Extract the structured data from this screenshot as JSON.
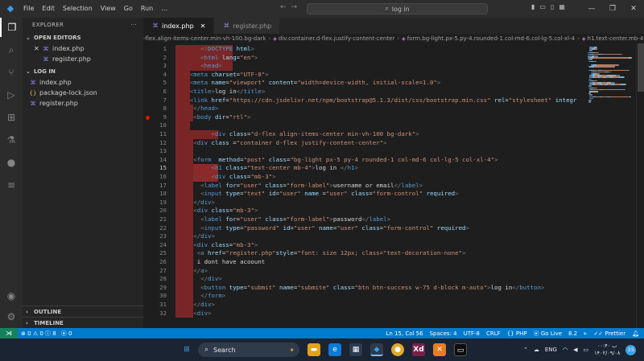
{
  "window": {
    "menu": [
      "File",
      "Edit",
      "Selection",
      "View",
      "Go",
      "Run",
      "…"
    ],
    "search_text": "log in"
  },
  "sidebar": {
    "title": "EXPLORER",
    "open_editors_title": "OPEN EDITORS",
    "open_editors": [
      "index.php",
      "register.php"
    ],
    "folder_title": "LOG IN",
    "files": [
      {
        "name": "index.php",
        "type": "php"
      },
      {
        "name": "package-lock.json",
        "type": "json"
      },
      {
        "name": "register.php",
        "type": "php"
      }
    ],
    "outline_title": "OUTLINE",
    "timeline_title": "TIMELINE"
  },
  "tabs": [
    {
      "label": "index.php",
      "active": true
    },
    {
      "label": "register.php",
      "active": false
    }
  ],
  "breadcrumb": [
    "-flex.align-items-center.min-vh-100.bg-dark",
    "div.container.d-flex.justify-content-center",
    "form.bg-light.px-5.py-4.rounded-1.col-md-6.col-lg-5.col-xl-4",
    "h1.text-center.mb-4"
  ],
  "editor": {
    "current_line": 15,
    "breakpoint_line": 9,
    "lines": [
      {
        "n": 1,
        "indent": 7,
        "hl": [
          8,
          24
        ],
        "seg": [
          [
            "p",
            "<!"
          ],
          [
            "t",
            "DOCTYPE"
          ],
          [
            "a",
            " html"
          ],
          [
            "p",
            ">"
          ]
        ]
      },
      {
        "n": 2,
        "indent": 7,
        "hl": [
          8,
          24
        ],
        "seg": [
          [
            "p",
            "<"
          ],
          [
            "t",
            "html"
          ],
          [
            "a",
            " lang"
          ],
          [
            "x2",
            "="
          ],
          [
            "s",
            "\"en\""
          ],
          [
            "p",
            ">"
          ]
        ]
      },
      {
        "n": 3,
        "indent": 7,
        "hl": [
          8,
          24
        ],
        "seg": [
          [
            "p",
            "<"
          ],
          [
            "t",
            "head"
          ],
          [
            "p",
            ">"
          ]
        ]
      },
      {
        "n": 4,
        "indent": 4,
        "hl": [
          8,
          12
        ],
        "seg": [
          [
            "p",
            "<"
          ],
          [
            "t",
            "meta"
          ],
          [
            "a",
            " charset"
          ],
          [
            "x2",
            "="
          ],
          [
            "s",
            "\"UTF-8\""
          ],
          [
            "p",
            ">"
          ]
        ]
      },
      {
        "n": 5,
        "indent": 4,
        "hl": [
          8,
          12
        ],
        "seg": [
          [
            "p",
            "<"
          ],
          [
            "t",
            "meta"
          ],
          [
            "a",
            " name"
          ],
          [
            "x2",
            "="
          ],
          [
            "s",
            "\"viewport\""
          ],
          [
            "a",
            " content"
          ],
          [
            "x2",
            "="
          ],
          [
            "s",
            "\"width=device-width, initial-scale=1.0\""
          ],
          [
            "p",
            ">"
          ]
        ]
      },
      {
        "n": 6,
        "indent": 4,
        "hl": [
          8,
          12
        ],
        "seg": [
          [
            "p",
            "<"
          ],
          [
            "t",
            "title"
          ],
          [
            "p",
            ">"
          ],
          [
            "x2",
            "log in"
          ],
          [
            "p",
            "</"
          ],
          [
            "t",
            "title"
          ],
          [
            "p",
            ">"
          ]
        ]
      },
      {
        "n": 7,
        "indent": 4,
        "hl": [
          8,
          12
        ],
        "seg": [
          [
            "p",
            "<"
          ],
          [
            "t",
            "link"
          ],
          [
            "a",
            " href"
          ],
          [
            "x2",
            "="
          ],
          [
            "s",
            "\"https://cdn.jsdelivr.net/npm/bootstrap@5.1.3/dist/css/bootstrap.min.css\""
          ],
          [
            "a",
            " rel"
          ],
          [
            "x2",
            "="
          ],
          [
            "s",
            "\"stylesheet\""
          ],
          [
            "a",
            " integr"
          ]
        ]
      },
      {
        "n": 8,
        "indent": 5,
        "hl": [
          8,
          13
        ],
        "seg": [
          [
            "p",
            "</"
          ],
          [
            "t",
            "head"
          ],
          [
            "p",
            ">"
          ]
        ]
      },
      {
        "n": 9,
        "indent": 5,
        "hl": [
          8,
          13
        ],
        "seg": [
          [
            "p",
            "<"
          ],
          [
            "t",
            "body"
          ],
          [
            "a",
            " dir"
          ],
          [
            "x2",
            "="
          ],
          [
            "s",
            "\"rtl\""
          ],
          [
            "p",
            ">"
          ]
        ]
      },
      {
        "n": 10,
        "indent": 0,
        "hl": [
          8,
          12
        ],
        "seg": []
      },
      {
        "n": 11,
        "indent": 10,
        "hl": [
          8,
          20
        ],
        "seg": [
          [
            "p",
            "<"
          ],
          [
            "t",
            "div"
          ],
          [
            "a",
            " class"
          ],
          [
            "x2",
            "="
          ],
          [
            "s",
            "\"d-flex align-items-center min-vh-100 bg-dark\""
          ],
          [
            "p",
            ">"
          ]
        ]
      },
      {
        "n": 12,
        "indent": 5,
        "hl": [
          8,
          13
        ],
        "seg": [
          [
            "p",
            "<"
          ],
          [
            "t",
            "div"
          ],
          [
            "a",
            " class "
          ],
          [
            "x2",
            "="
          ],
          [
            "s",
            "\"container d-flex justify-content-center\""
          ],
          [
            "p",
            ">"
          ]
        ]
      },
      {
        "n": 13,
        "indent": 0,
        "hl": [
          8,
          13
        ],
        "seg": []
      },
      {
        "n": 14,
        "indent": 5,
        "hl": [
          8,
          13
        ],
        "seg": [
          [
            "p",
            "<"
          ],
          [
            "t",
            "form"
          ],
          [
            "a",
            "  method"
          ],
          [
            "x2",
            "="
          ],
          [
            "s",
            "\"post\""
          ],
          [
            "a",
            " class"
          ],
          [
            "x2",
            "="
          ],
          [
            "s",
            "\"bg-light px-5 py-4 rounded-1 col-md-6 col-lg-5 col-xl-4\""
          ],
          [
            "p",
            ">"
          ]
        ]
      },
      {
        "n": 15,
        "indent": 10,
        "hl": [
          8,
          13
        ],
        "inner": [
          13,
          20
        ],
        "seg": [
          [
            "p",
            "<"
          ],
          [
            "t",
            "h1"
          ],
          [
            "a",
            " class"
          ],
          [
            "x2",
            "="
          ],
          [
            "s",
            "\"text-center mb-4\""
          ],
          [
            "p",
            ">"
          ],
          [
            "x2",
            "log in "
          ],
          [
            "p",
            "</"
          ],
          [
            "t",
            "h1"
          ],
          [
            "p",
            ">"
          ]
        ]
      },
      {
        "n": 16,
        "indent": 10,
        "hl": [
          8,
          13
        ],
        "inner": [
          13,
          20
        ],
        "seg": [
          [
            "p",
            "<"
          ],
          [
            "t",
            "div"
          ],
          [
            "a",
            " class"
          ],
          [
            "x2",
            "="
          ],
          [
            "s",
            "\"mb-3\""
          ],
          [
            "p",
            ">"
          ]
        ]
      },
      {
        "n": 17,
        "indent": 7,
        "hl": [
          8,
          13
        ],
        "seg": [
          [
            "p",
            "<"
          ],
          [
            "t",
            "label"
          ],
          [
            "a",
            " for"
          ],
          [
            "x2",
            "="
          ],
          [
            "s",
            "\"user\""
          ],
          [
            "a",
            " class"
          ],
          [
            "x2",
            "="
          ],
          [
            "s",
            "\"form-label\""
          ],
          [
            "p",
            ">"
          ],
          [
            "x2",
            "username or email"
          ],
          [
            "p",
            "</"
          ],
          [
            "t",
            "label"
          ],
          [
            "p",
            ">"
          ]
        ]
      },
      {
        "n": 18,
        "indent": 7,
        "hl": [
          8,
          13
        ],
        "seg": [
          [
            "p",
            "<"
          ],
          [
            "t",
            "input"
          ],
          [
            "a",
            " type"
          ],
          [
            "x2",
            "="
          ],
          [
            "s",
            "\"text\""
          ],
          [
            "a",
            " id"
          ],
          [
            "x2",
            "="
          ],
          [
            "s",
            "\"user\""
          ],
          [
            "a",
            " name "
          ],
          [
            "x2",
            "="
          ],
          [
            "s",
            "\"user\""
          ],
          [
            "a",
            " class"
          ],
          [
            "x2",
            "="
          ],
          [
            "s",
            "\"form-control\""
          ],
          [
            "a",
            " required"
          ],
          [
            "p",
            ">"
          ]
        ]
      },
      {
        "n": 19,
        "indent": 5,
        "hl": [
          8,
          13
        ],
        "seg": [
          [
            "p",
            "</"
          ],
          [
            "t",
            "div"
          ],
          [
            "p",
            ">"
          ]
        ]
      },
      {
        "n": 20,
        "indent": 5,
        "hl": [
          8,
          13
        ],
        "seg": [
          [
            "p",
            "<"
          ],
          [
            "t",
            "div"
          ],
          [
            "a",
            " class"
          ],
          [
            "x2",
            "="
          ],
          [
            "s",
            "\"mb-3\""
          ],
          [
            "p",
            ">"
          ]
        ]
      },
      {
        "n": 21,
        "indent": 7,
        "hl": [
          8,
          13
        ],
        "seg": [
          [
            "p",
            "<"
          ],
          [
            "t",
            "label"
          ],
          [
            "a",
            " for"
          ],
          [
            "x2",
            "="
          ],
          [
            "s",
            "\"user\""
          ],
          [
            "a",
            " class"
          ],
          [
            "x2",
            "="
          ],
          [
            "s",
            "\"form-label\""
          ],
          [
            "p",
            ">"
          ],
          [
            "x2",
            "password"
          ],
          [
            "p",
            "</"
          ],
          [
            "t",
            "label"
          ],
          [
            "p",
            ">"
          ]
        ]
      },
      {
        "n": 22,
        "indent": 7,
        "hl": [
          8,
          13
        ],
        "seg": [
          [
            "p",
            "<"
          ],
          [
            "t",
            "input"
          ],
          [
            "a",
            " type"
          ],
          [
            "x2",
            "="
          ],
          [
            "s",
            "\"password\""
          ],
          [
            "a",
            " id"
          ],
          [
            "x2",
            "="
          ],
          [
            "s",
            "\"user\""
          ],
          [
            "a",
            " name"
          ],
          [
            "x2",
            "="
          ],
          [
            "s",
            "\"user\""
          ],
          [
            "a",
            " class"
          ],
          [
            "x2",
            "="
          ],
          [
            "s",
            "\"form-control\""
          ],
          [
            "a",
            " required"
          ],
          [
            "p",
            ">"
          ]
        ]
      },
      {
        "n": 23,
        "indent": 5,
        "hl": [
          8,
          13
        ],
        "seg": [
          [
            "p",
            "</"
          ],
          [
            "t",
            "div"
          ],
          [
            "p",
            ">"
          ]
        ]
      },
      {
        "n": 24,
        "indent": 5,
        "hl": [
          8,
          13
        ],
        "seg": [
          [
            "p",
            "<"
          ],
          [
            "t",
            "div"
          ],
          [
            "a",
            " class"
          ],
          [
            "x2",
            "="
          ],
          [
            "s",
            "\"mb-3\""
          ],
          [
            "p",
            ">"
          ]
        ]
      },
      {
        "n": 25,
        "indent": 6,
        "hl": [
          8,
          13
        ],
        "seg": [
          [
            "p",
            "<"
          ],
          [
            "t",
            "a"
          ],
          [
            "a",
            " href"
          ],
          [
            "x2",
            "="
          ],
          [
            "s",
            "\"register.php\""
          ],
          [
            "a",
            "style"
          ],
          [
            "x2",
            "="
          ],
          [
            "s",
            "\"font: size 12px; class=\"text-decoration-none\""
          ],
          [
            "p",
            ">"
          ]
        ]
      },
      {
        "n": 26,
        "indent": 6,
        "hl": [
          8,
          13
        ],
        "seg": [
          [
            "x2",
            "i dont have acoount"
          ]
        ]
      },
      {
        "n": 27,
        "indent": 5,
        "hl": [
          8,
          13
        ],
        "seg": [
          [
            "p",
            "</"
          ],
          [
            "t",
            "a"
          ],
          [
            "p",
            ">"
          ]
        ]
      },
      {
        "n": 28,
        "indent": 7,
        "hl": [
          8,
          13
        ],
        "seg": [
          [
            "p",
            "</"
          ],
          [
            "t",
            "div"
          ],
          [
            "p",
            ">"
          ]
        ]
      },
      {
        "n": 29,
        "indent": 7,
        "hl": [
          8,
          13
        ],
        "seg": [
          [
            "p",
            "<"
          ],
          [
            "t",
            "button"
          ],
          [
            "a",
            " type"
          ],
          [
            "x2",
            "="
          ],
          [
            "s",
            "\"submit\""
          ],
          [
            "a",
            " name"
          ],
          [
            "x2",
            "="
          ],
          [
            "s",
            "\"submite\""
          ],
          [
            "a",
            " class"
          ],
          [
            "x2",
            "="
          ],
          [
            "s",
            "\"btn btn-success w-75 d-block m-auto\""
          ],
          [
            "p",
            ">"
          ],
          [
            "x2",
            "log in"
          ],
          [
            "p",
            "</"
          ],
          [
            "t",
            "button"
          ],
          [
            "p",
            ">"
          ]
        ]
      },
      {
        "n": 30,
        "indent": 7,
        "hl": [
          8,
          13
        ],
        "seg": [
          [
            "p",
            "</"
          ],
          [
            "t",
            "form"
          ],
          [
            "p",
            ">"
          ]
        ]
      },
      {
        "n": 31,
        "indent": 5,
        "hl": [
          8,
          13
        ],
        "seg": [
          [
            "p",
            "</"
          ],
          [
            "t",
            "div"
          ],
          [
            "p",
            ">"
          ]
        ]
      },
      {
        "n": 32,
        "indent": 5,
        "hl": [
          8,
          13
        ],
        "seg": [
          [
            "p",
            "<"
          ],
          [
            "t",
            "div"
          ],
          [
            "p",
            ">"
          ]
        ]
      }
    ]
  },
  "status": {
    "errors": "0",
    "warnings": "0",
    "info": "8",
    "ports": "0",
    "position": "Ln 15, Col 56",
    "spaces": "Spaces: 4",
    "encoding": "UTF-8",
    "eol": "CRLF",
    "language": "PHP",
    "golive": "Go Live",
    "version": "8.2",
    "prettier": "Prettier"
  },
  "taskbar": {
    "search_label": "Search",
    "language": "ENG",
    "time": "۰۰:۴۰ ب",
    "date": "۱۴۰۲/۰۹/۰۸",
    "notifications": "15"
  },
  "colors": {
    "accent": "#007acc",
    "highlight": "#7a2626",
    "breakpoint": "#e51400"
  }
}
